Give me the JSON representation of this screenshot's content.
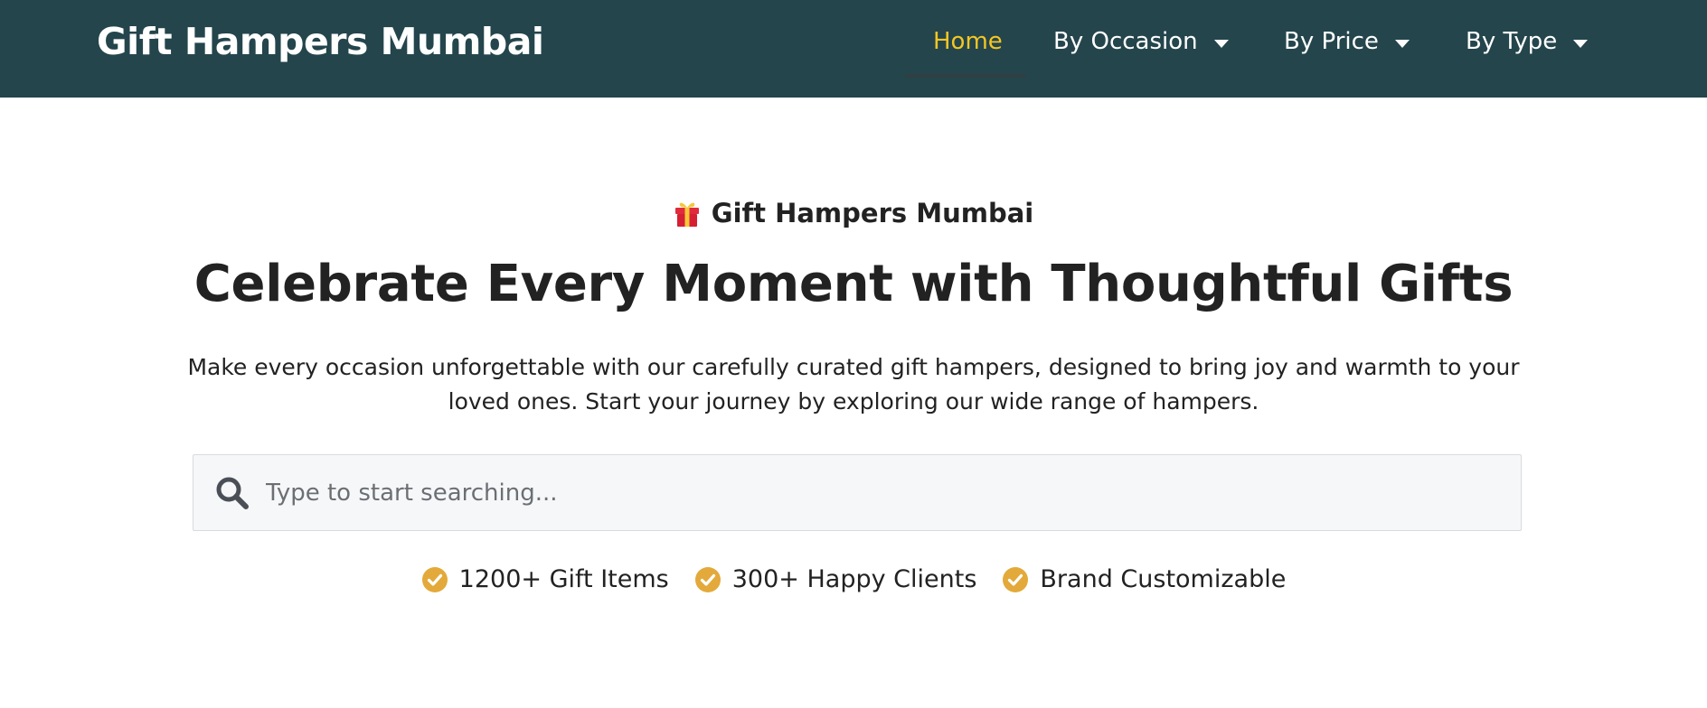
{
  "header": {
    "brand": "Gift Hampers Mumbai",
    "nav": [
      {
        "label": "Home",
        "active": true,
        "has_dropdown": false
      },
      {
        "label": "By Occasion",
        "active": false,
        "has_dropdown": true
      },
      {
        "label": "By Price",
        "active": false,
        "has_dropdown": true
      },
      {
        "label": "By Type",
        "active": false,
        "has_dropdown": true
      }
    ]
  },
  "hero": {
    "eyebrow_icon": "gift-icon",
    "eyebrow": "Gift Hampers Mumbai",
    "title": "Celebrate Every Moment with Thoughtful Gifts",
    "subtitle": "Make every occasion unforgettable with our carefully curated gift hampers, designed to bring joy and warmth to your loved ones. Start your journey by exploring our wide range of hampers."
  },
  "search": {
    "icon": "search-icon",
    "placeholder": "Type to start searching...",
    "value": ""
  },
  "features": [
    {
      "icon": "check-circle-icon",
      "label": "1200+ Gift Items"
    },
    {
      "icon": "check-circle-icon",
      "label": "300+ Happy Clients"
    },
    {
      "icon": "check-circle-icon",
      "label": "Brand Customizable"
    }
  ],
  "colors": {
    "header_bg": "#24454c",
    "nav_active": "#f3c623",
    "check_icon": "#e3a93a",
    "text": "#222222"
  }
}
